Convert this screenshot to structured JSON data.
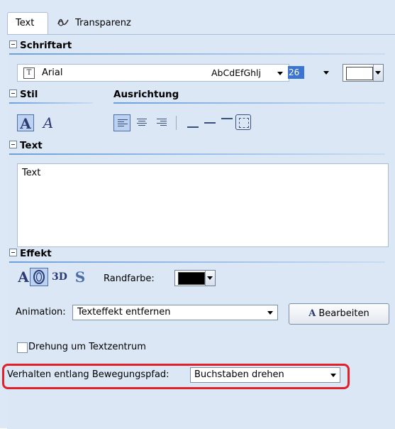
{
  "tabs": [
    {
      "label": "Text",
      "active": true
    },
    {
      "label": "Transparenz",
      "active": false
    }
  ],
  "sections": {
    "schriftart": "Schriftart",
    "stil": "Stil",
    "ausrichtung": "Ausrichtung",
    "text": "Text",
    "effekt": "Effekt"
  },
  "font": {
    "name": "Arial",
    "sample": "AbCdEfGhlj",
    "size": "26",
    "color": "#ffffff"
  },
  "text_content": "Text",
  "effect": {
    "three_d_label": "3D",
    "border_color_label": "Randfarbe:",
    "border_color": "#000000"
  },
  "animation": {
    "label": "Animation:",
    "value": "Texteffekt entfernen",
    "edit_button": "Bearbeiten"
  },
  "rotate_checkbox": {
    "label": "Drehung um Textzentrum",
    "checked": false
  },
  "path_behavior": {
    "label": "Verhalten entlang Bewegungspfad:",
    "value": "Buchstaben drehen"
  },
  "colors": {
    "panel_bg": "#dce7f6",
    "accent": "#3b74d1",
    "highlight": "#e2202a"
  }
}
